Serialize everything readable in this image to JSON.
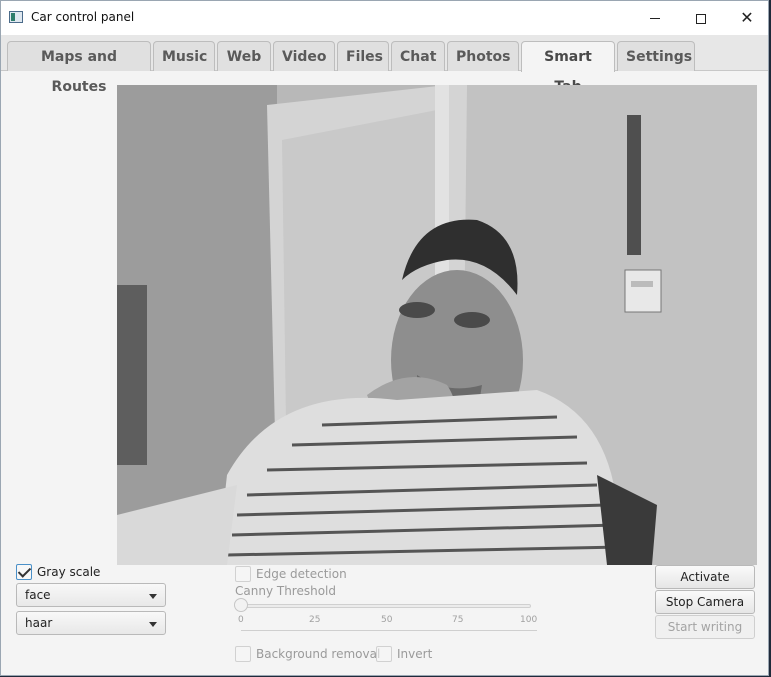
{
  "window": {
    "title": "Car control panel"
  },
  "tabs": [
    {
      "label": "Maps and Routes"
    },
    {
      "label": "Music"
    },
    {
      "label": "Web"
    },
    {
      "label": "Video"
    },
    {
      "label": "Files"
    },
    {
      "label": "Chat"
    },
    {
      "label": "Photos"
    },
    {
      "label": "Smart Tab",
      "active": true
    },
    {
      "label": "Settings"
    }
  ],
  "controls": {
    "gray_scale": {
      "label": "Gray scale",
      "checked": true
    },
    "detector_target": {
      "value": "face"
    },
    "classifier_type": {
      "value": "haar"
    },
    "edge_detection": {
      "label": "Edge detection",
      "checked": false,
      "enabled": false
    },
    "canny_threshold": {
      "label": "Canny Threshold",
      "value": 0,
      "min": 0,
      "max": 100,
      "tick_labels": [
        "0",
        "25",
        "50",
        "75",
        "100"
      ],
      "enabled": false
    },
    "background_removal": {
      "label": "Background removal",
      "checked": false,
      "enabled": false
    },
    "invert": {
      "label": "Invert",
      "checked": false,
      "enabled": false
    }
  },
  "buttons": {
    "activate_camera": "Activate camera",
    "stop_camera": "Stop Camera",
    "start_writing": "Start writing"
  },
  "camera": {
    "mode": "grayscale webcam feed"
  },
  "colors": {
    "accent": "#4a90c8",
    "disabled_text": "#9a9a9a"
  }
}
